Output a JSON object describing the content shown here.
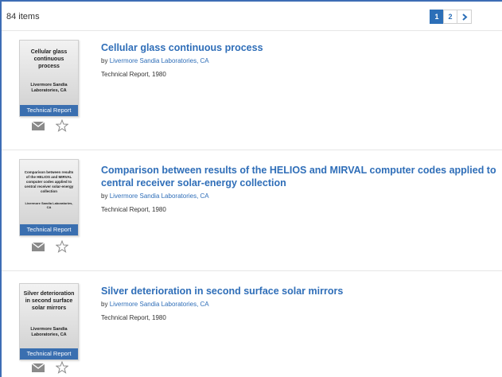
{
  "header": {
    "items_count": "84 items",
    "pagination": {
      "pages": [
        "1",
        "2"
      ],
      "current": "1",
      "next_icon": "chevron-right"
    }
  },
  "results": [
    {
      "title": "Cellular glass continuous process",
      "by_label": "by",
      "author": "Livermore Sandia Laboratories, CA",
      "meta": "Technical Report, 1980",
      "cover": {
        "title": "Cellular glass continuous process",
        "author": "Livermore Sandia Laboratories, CA",
        "band": "Technical Report"
      }
    },
    {
      "title": "Comparison between results of the HELIOS and MIRVAL computer codes applied to central receiver solar-energy collection",
      "by_label": "by",
      "author": "Livermore Sandia Laboratories, CA",
      "meta": "Technical Report, 1980",
      "cover": {
        "title": "Comparison between results of the HELIOS and MIRVAL computer codes applied to central receiver solar-energy collection",
        "author": "Livermore Sandia Laboratories, CA",
        "band": "Technical Report"
      }
    },
    {
      "title": "Silver deterioration in second surface solar mirrors",
      "by_label": "by",
      "author": "Livermore Sandia Laboratories, CA",
      "meta": "Technical Report, 1980",
      "cover": {
        "title": "Silver deterioration in second surface solar mirrors",
        "author": "Livermore Sandia Laboratories, CA",
        "band": "Technical Report"
      }
    }
  ],
  "icons": {
    "email": "envelope-icon",
    "favorite": "star-outline-icon"
  },
  "colors": {
    "link": "#2f6eb8",
    "accent": "#3a6fb0",
    "border": "#3d6db5"
  }
}
